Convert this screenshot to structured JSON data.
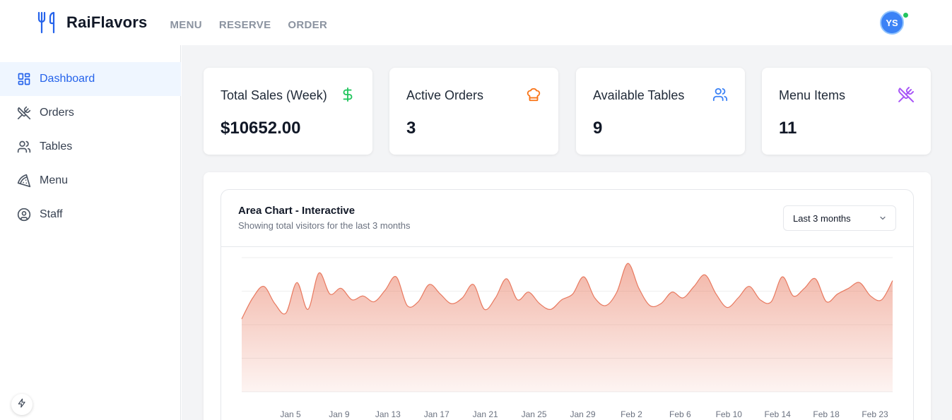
{
  "app": {
    "brand": "RaiFlavors",
    "user_initials": "YS"
  },
  "topnav": [
    "MENU",
    "RESERVE",
    "ORDER"
  ],
  "sidebar": {
    "items": [
      {
        "label": "Dashboard",
        "icon": "dashboard-icon",
        "active": true
      },
      {
        "label": "Orders",
        "icon": "utensils-crossed-icon",
        "active": false
      },
      {
        "label": "Tables",
        "icon": "users-icon",
        "active": false
      },
      {
        "label": "Menu",
        "icon": "pizza-icon",
        "active": false
      },
      {
        "label": "Staff",
        "icon": "user-circle-icon",
        "active": false
      }
    ]
  },
  "stats": [
    {
      "title": "Total Sales (Week)",
      "value": "$10652.00",
      "icon": "dollar-icon",
      "color": "#22c55e"
    },
    {
      "title": "Active Orders",
      "value": "3",
      "icon": "chef-hat-icon",
      "color": "#f97316"
    },
    {
      "title": "Available Tables",
      "value": "9",
      "icon": "users-icon",
      "color": "#3b82f6"
    },
    {
      "title": "Menu Items",
      "value": "11",
      "icon": "utensils-crossed-icon",
      "color": "#a855f7"
    }
  ],
  "chart": {
    "title": "Area Chart - Interactive",
    "subtitle": "Showing total visitors for the last 3 months",
    "range_label": "Last 3 months"
  },
  "chart_data": {
    "type": "area",
    "grid": true,
    "fill_color": "#e8795f",
    "x_tick_labels": [
      "Jan 5",
      "Jan 9",
      "Jan 13",
      "Jan 17",
      "Jan 21",
      "Jan 25",
      "Jan 29",
      "Feb 2",
      "Feb 6",
      "Feb 10",
      "Feb 14",
      "Feb 18",
      "Feb 23"
    ],
    "series": [
      {
        "values": [
          190,
          245,
          275,
          230,
          205,
          285,
          215,
          310,
          255,
          270,
          240,
          250,
          235,
          265,
          300,
          225,
          235,
          280,
          255,
          230,
          245,
          280,
          215,
          245,
          295,
          240,
          260,
          230,
          215,
          240,
          255,
          300,
          245,
          225,
          260,
          335,
          270,
          225,
          230,
          260,
          245,
          275,
          305,
          255,
          220,
          245,
          275,
          240,
          235,
          300,
          250,
          270,
          295,
          235,
          255,
          270,
          285,
          250,
          240,
          290
        ]
      }
    ]
  }
}
